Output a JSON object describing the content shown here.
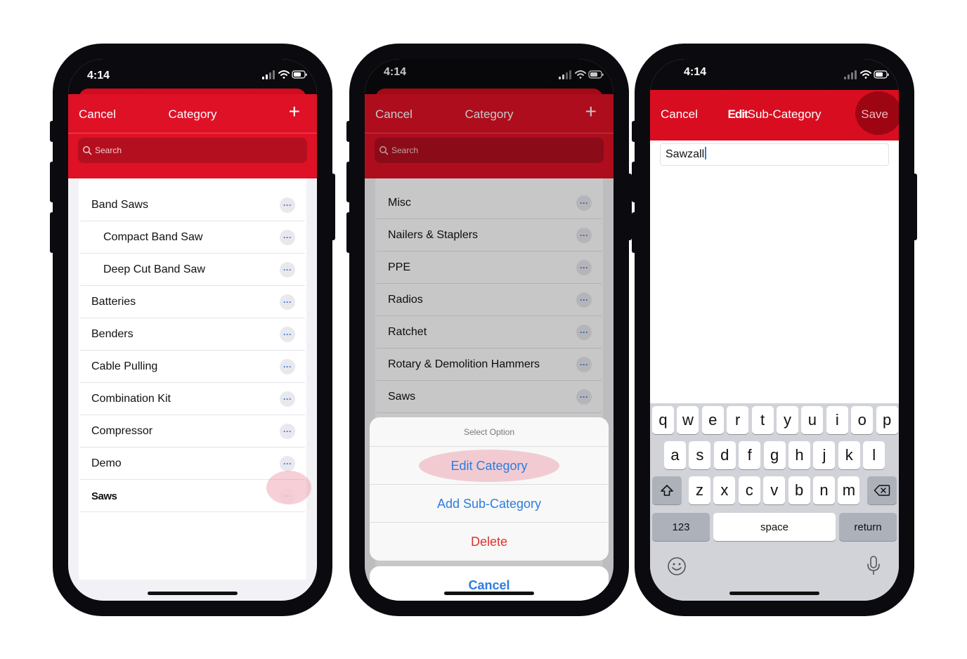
{
  "status": {
    "time": "4:14"
  },
  "screen1": {
    "nav": {
      "left": "Cancel",
      "title": "Category",
      "right": "+"
    },
    "search_placeholder": "Search",
    "rows": [
      {
        "label": "Band Saws",
        "sub": false
      },
      {
        "label": "Compact Band Saw",
        "sub": true
      },
      {
        "label": "Deep Cut Band Saw",
        "sub": true
      },
      {
        "label": "Batteries",
        "sub": false
      },
      {
        "label": "Benders",
        "sub": false
      },
      {
        "label": "Cable Pulling",
        "sub": false
      },
      {
        "label": "Combination Kit",
        "sub": false
      },
      {
        "label": "Compressor",
        "sub": false
      },
      {
        "label": "Demo",
        "sub": false
      },
      {
        "label": "Saws",
        "sub": false
      }
    ],
    "more_glyph": "···"
  },
  "screen2": {
    "nav": {
      "left": "Cancel",
      "title": "Category",
      "right": "+"
    },
    "search_placeholder": "Search",
    "rows": [
      "Misc",
      "Nailers & Staplers",
      "PPE",
      "Radios",
      "Ratchet",
      "Rotary & Demolition Hammers",
      "Saws"
    ],
    "sheet": {
      "title": "Select Option",
      "options": [
        "Edit Category",
        "Add Sub-Category",
        "Delete"
      ],
      "cancel": "Cancel"
    }
  },
  "screen3": {
    "nav": {
      "left": "Cancel",
      "title_a": "Edit",
      "title_b": "Sub-Category",
      "right": "Save"
    },
    "input_value": "Sawzall",
    "keyboard": {
      "row1": [
        "q",
        "w",
        "e",
        "r",
        "t",
        "y",
        "u",
        "i",
        "o",
        "p"
      ],
      "row2": [
        "a",
        "s",
        "d",
        "f",
        "g",
        "h",
        "j",
        "k",
        "l"
      ],
      "row3": [
        "z",
        "x",
        "c",
        "v",
        "b",
        "n",
        "m"
      ],
      "numbers": "123",
      "space": "space",
      "return": "return"
    }
  },
  "colors": {
    "brand_red": "#df1126",
    "link_blue": "#2b7de0",
    "destructive_red": "#e0322a"
  }
}
